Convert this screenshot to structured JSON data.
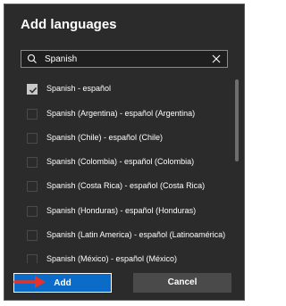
{
  "dialog": {
    "title": "Add languages"
  },
  "search": {
    "value": "Spanish",
    "icon": "search-icon",
    "clear_icon": "close-icon"
  },
  "languages": [
    {
      "label": "Spanish - español",
      "checked": true
    },
    {
      "label": "Spanish (Argentina) - español (Argentina)",
      "checked": false
    },
    {
      "label": "Spanish (Chile) - español (Chile)",
      "checked": false
    },
    {
      "label": "Spanish (Colombia) - español (Colombia)",
      "checked": false
    },
    {
      "label": "Spanish (Costa Rica) - español (Costa Rica)",
      "checked": false
    },
    {
      "label": "Spanish (Honduras) - español (Honduras)",
      "checked": false
    },
    {
      "label": "Spanish (Latin America) - español (Latinoamérica)",
      "checked": false
    },
    {
      "label": "Spanish (México) - español (México)",
      "checked": false
    }
  ],
  "footer": {
    "add_label": "Add",
    "cancel_label": "Cancel"
  },
  "colors": {
    "dialog_bg": "#2b2b2b",
    "accent": "#0a6cc8",
    "annotation_arrow": "#e8302c"
  }
}
